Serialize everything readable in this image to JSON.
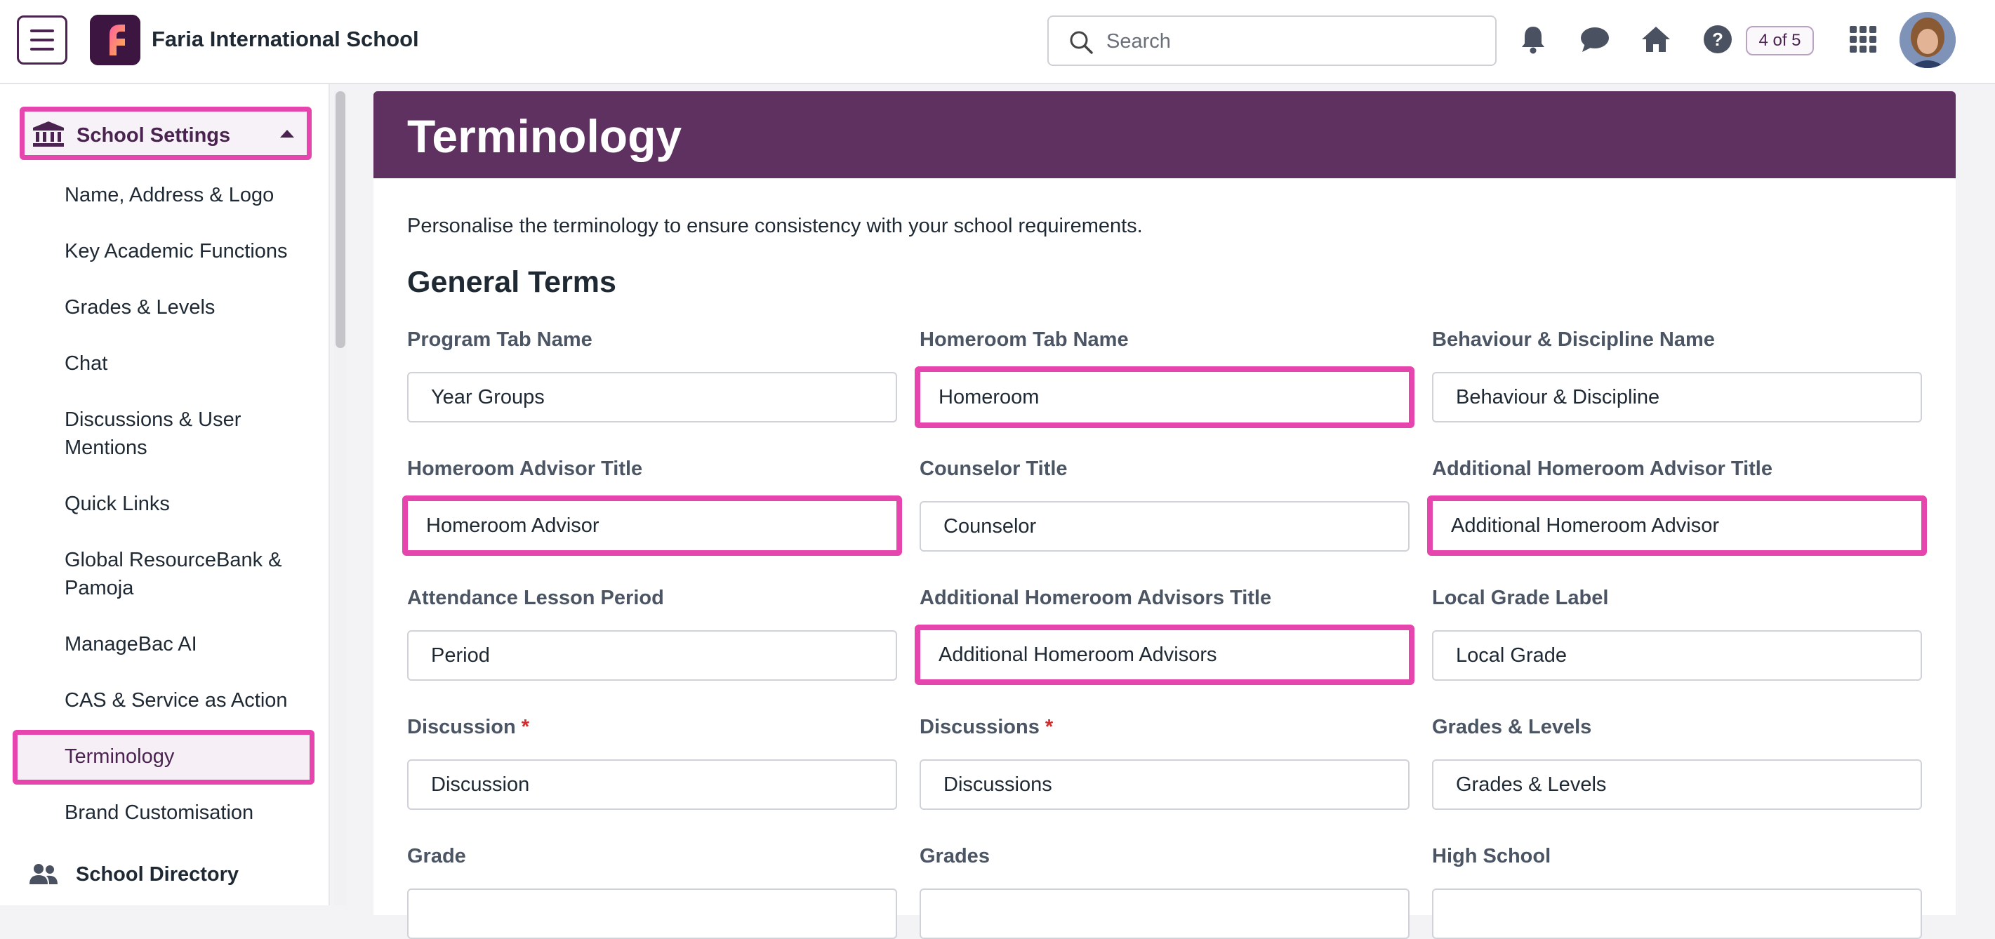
{
  "header": {
    "school_name": "Faria International School",
    "logo_letter": "f",
    "search_placeholder": "Search",
    "tour_badge": "4 of 5",
    "icons": [
      "menu-icon",
      "bell-icon",
      "chat-icon",
      "home-icon",
      "help-icon",
      "apps-grid-icon",
      "avatar"
    ]
  },
  "sidebar": {
    "section_title": "School Settings",
    "items": [
      "Name, Address & Logo",
      "Key Academic Functions",
      "Grades & Levels",
      "Chat",
      "Discussions & User Mentions",
      "Quick Links",
      "Global ResourceBank & Pamoja",
      "ManageBac AI",
      "CAS & Service as Action",
      "Terminology",
      "Brand Customisation"
    ],
    "active_item": "Terminology",
    "next_section": "School Directory"
  },
  "main": {
    "page_title": "Terminology",
    "intro": "Personalise the terminology to ensure consistency with your school requirements.",
    "section_title": "General Terms",
    "fields": [
      {
        "label": "Program Tab Name",
        "value": "Year Groups",
        "required": false,
        "highlighted": false
      },
      {
        "label": "Homeroom Tab Name",
        "value": "Homeroom",
        "required": false,
        "highlighted": true
      },
      {
        "label": "Behaviour & Discipline Name",
        "value": "Behaviour & Discipline",
        "required": false,
        "highlighted": false
      },
      {
        "label": "Homeroom Advisor Title",
        "value": "Homeroom Advisor",
        "required": false,
        "highlighted": true
      },
      {
        "label": "Counselor Title",
        "value": "Counselor",
        "required": false,
        "highlighted": false
      },
      {
        "label": "Additional Homeroom Advisor Title",
        "value": "Additional Homeroom Advisor",
        "required": false,
        "highlighted": true
      },
      {
        "label": "Attendance Lesson Period",
        "value": "Period",
        "required": false,
        "highlighted": false
      },
      {
        "label": "Additional Homeroom Advisors Title",
        "value": "Additional Homeroom Advisors",
        "required": false,
        "highlighted": true
      },
      {
        "label": "Local Grade Label",
        "value": "Local Grade",
        "required": false,
        "highlighted": false
      },
      {
        "label": "Discussion",
        "value": "Discussion",
        "required": true,
        "highlighted": false
      },
      {
        "label": "Discussions",
        "value": "Discussions",
        "required": true,
        "highlighted": false
      },
      {
        "label": "Grades & Levels",
        "value": "Grades & Levels",
        "required": false,
        "highlighted": false
      },
      {
        "label": "Grade",
        "value": "",
        "required": false,
        "highlighted": false
      },
      {
        "label": "Grades",
        "value": "",
        "required": false,
        "highlighted": false
      },
      {
        "label": "High School",
        "value": "",
        "required": false,
        "highlighted": false
      }
    ],
    "required_marker": "*"
  },
  "colors": {
    "brand_purple": "#5e3160",
    "highlight_pink": "#e545ad",
    "required_red": "#d92b2b"
  }
}
